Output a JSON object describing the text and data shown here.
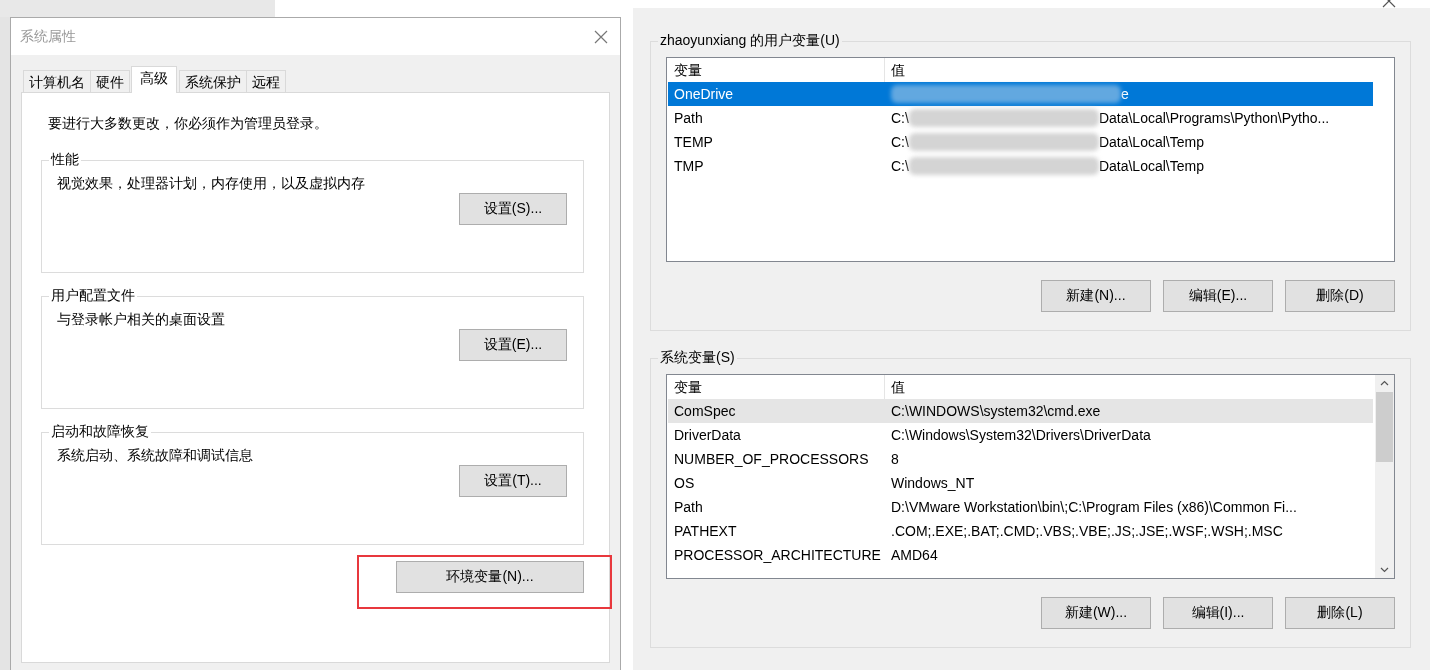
{
  "system_properties": {
    "title": "系统属性",
    "tabs": [
      {
        "label": "计算机名",
        "selected": false
      },
      {
        "label": "硬件",
        "selected": false
      },
      {
        "label": "高级",
        "selected": true
      },
      {
        "label": "系统保护",
        "selected": false
      },
      {
        "label": "远程",
        "selected": false
      }
    ],
    "notice": "要进行大多数更改，你必须作为管理员登录。",
    "groups": [
      {
        "title": "性能",
        "description": "视觉效果，处理器计划，内存使用，以及虚拟内存",
        "button": "设置(S)..."
      },
      {
        "title": "用户配置文件",
        "description": "与登录帐户相关的桌面设置",
        "button": "设置(E)..."
      },
      {
        "title": "启动和故障恢复",
        "description": "系统启动、系统故障和调试信息",
        "button": "设置(T)..."
      }
    ],
    "env_button": {
      "label": "环境变量(N)...",
      "highlighted": true
    }
  },
  "environment_variables": {
    "user_vars": {
      "title": "zhaoyunxiang 的用户变量(U)",
      "columns": [
        "变量",
        "值"
      ],
      "rows": [
        {
          "name": "OneDrive",
          "value_end": "e",
          "redacted": true,
          "selected": true
        },
        {
          "name": "Path",
          "value_start": "C:\\",
          "value_end": "Data\\Local\\Programs\\Python\\Pytho...",
          "redacted": true,
          "selected": false
        },
        {
          "name": "TEMP",
          "value_start": "C:\\",
          "value_end": "Data\\Local\\Temp",
          "redacted": true,
          "selected": false
        },
        {
          "name": "TMP",
          "value_start": "C:\\",
          "value_end": "Data\\Local\\Temp",
          "redacted": true,
          "selected": false
        }
      ],
      "buttons": [
        "新建(N)...",
        "编辑(E)...",
        "删除(D)"
      ]
    },
    "system_vars": {
      "title": "系统变量(S)",
      "columns": [
        "变量",
        "值"
      ],
      "rows": [
        {
          "name": "ComSpec",
          "value_end": "C:\\WINDOWS\\system32\\cmd.exe",
          "redacted": false,
          "selected": false,
          "hovered": true
        },
        {
          "name": "DriverData",
          "value_end": "C:\\Windows\\System32\\Drivers\\DriverData",
          "redacted": false,
          "selected": false,
          "hovered": false
        },
        {
          "name": "NUMBER_OF_PROCESSORS",
          "value_end": "8",
          "redacted": false,
          "selected": false,
          "hovered": false
        },
        {
          "name": "OS",
          "value_end": "Windows_NT",
          "redacted": false,
          "selected": false,
          "hovered": false
        },
        {
          "name": "Path",
          "value_end": "D:\\VMware Workstation\\bin\\;C:\\Program Files (x86)\\Common Fi...",
          "redacted": false,
          "selected": false,
          "hovered": false
        },
        {
          "name": "PATHEXT",
          "value_end": ".COM;.EXE;.BAT;.CMD;.VBS;.VBE;.JS;.JSE;.WSF;.WSH;.MSC",
          "redacted": false,
          "selected": false,
          "hovered": false
        },
        {
          "name": "PROCESSOR_ARCHITECTURE",
          "value_end": "AMD64",
          "redacted": false,
          "selected": false,
          "hovered": false
        }
      ],
      "buttons": [
        "新建(W)...",
        "编辑(I)...",
        "删除(L)"
      ]
    }
  }
}
